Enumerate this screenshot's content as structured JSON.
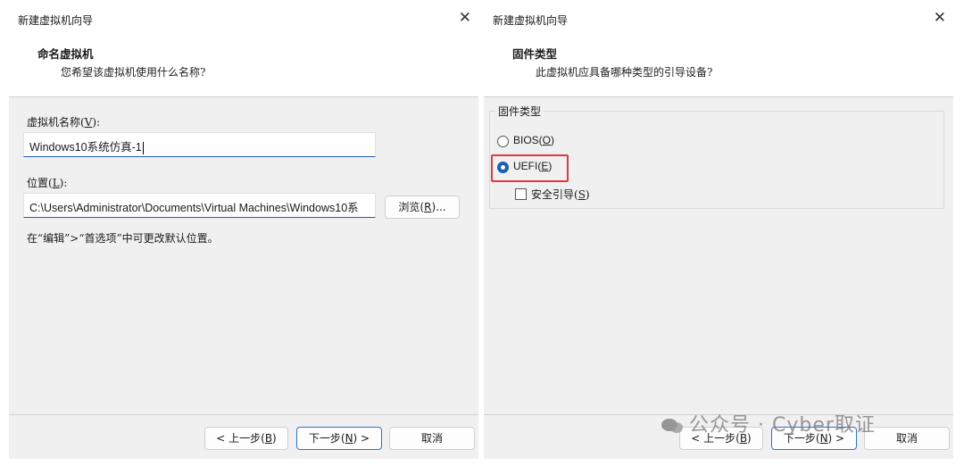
{
  "left_dialog": {
    "title": "新建虚拟机向导",
    "close": "✕",
    "header_title": "命名虚拟机",
    "header_subtitle": "您希望该虚拟机使用什么名称?",
    "name_label": "虚拟机名称(",
    "name_key": "V",
    "name_label_end": "):",
    "name_value": "Windows10系统仿真-1",
    "location_label": "位置(",
    "location_key": "L",
    "location_label_end": "):",
    "location_value": "C:\\Users\\Administrator\\Documents\\Virtual Machines\\Windows10系",
    "browse_text": "浏览(",
    "browse_key": "R",
    "browse_end": ")...",
    "hint": "在“编辑”>“首选项”中可更改默认位置。",
    "back_text": "< 上一步(",
    "back_key": "B",
    "back_end": ")",
    "next_text": "下一步(",
    "next_key": "N",
    "next_end": ") >",
    "cancel": "取消"
  },
  "right_dialog": {
    "title": "新建虚拟机向导",
    "close": "✕",
    "header_title": "固件类型",
    "header_subtitle": "此虚拟机应具备哪种类型的引导设备?",
    "group_label": "固件类型",
    "bios_text": "BIOS(",
    "bios_key": "O",
    "bios_end": ")",
    "uefi_text": "UEFI(",
    "uefi_key": "E",
    "uefi_end": ")",
    "secure_boot_text": "安全引导(",
    "secure_boot_key": "S",
    "secure_boot_end": ")",
    "selected_firmware": "UEFI",
    "secure_boot_checked": false,
    "back_text": "< 上一步(",
    "back_key": "B",
    "back_end": ")",
    "next_text": "下一步(",
    "next_key": "N",
    "next_end": ") >",
    "cancel": "取消"
  },
  "watermark": "公众号 · Cyber取证",
  "colors": {
    "accent": "#1a5fb4",
    "highlight": "#e0393e",
    "dialog_bg": "#f0f0f0"
  }
}
